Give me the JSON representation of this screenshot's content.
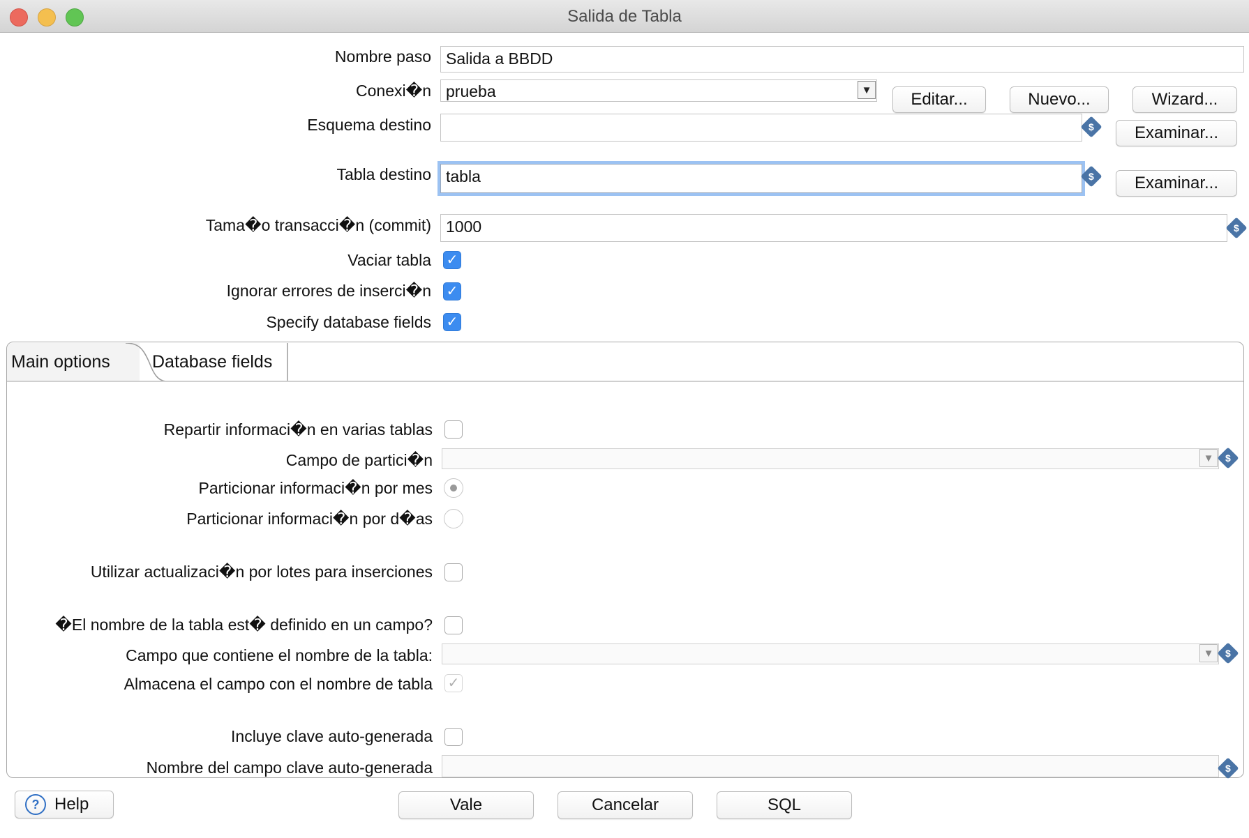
{
  "window": {
    "title": "Salida de Tabla"
  },
  "form": {
    "step_name": {
      "label": "Nombre paso",
      "value": "Salida a BBDD"
    },
    "connection": {
      "label": "Conexi�n",
      "value": "prueba"
    },
    "buttons": {
      "edit": "Editar...",
      "new": "Nuevo...",
      "wizard": "Wizard...",
      "browse": "Examinar..."
    },
    "target_schema": {
      "label": "Esquema destino",
      "value": ""
    },
    "target_table": {
      "label": "Tabla destino",
      "value": "tabla"
    },
    "commit_size": {
      "label": "Tama�o transacci�n (commit)",
      "value": "1000"
    },
    "truncate_table": {
      "label": "Vaciar tabla",
      "checked": true
    },
    "ignore_insert_errors": {
      "label": "Ignorar errores de inserci�n",
      "checked": true
    },
    "specify_db_fields": {
      "label": "Specify database fields",
      "checked": true
    }
  },
  "tabs": [
    {
      "label": "Main options",
      "active": true
    },
    {
      "label": "Database fields",
      "active": false
    }
  ],
  "main_options": {
    "partition_over_tables": {
      "label": "Repartir informaci�n en varias tablas",
      "checked": false
    },
    "partition_field": {
      "label": "Campo de partici�n",
      "value": ""
    },
    "partition_monthly": {
      "label": "Particionar informaci�n por mes",
      "selected": true
    },
    "partition_daily": {
      "label": "Particionar informaci�n por d�as",
      "selected": false
    },
    "batch_updates": {
      "label": "Utilizar actualizaci�n por lotes para inserciones",
      "checked": false
    },
    "table_name_in_field": {
      "label": "�El nombre de la tabla est� definido en un campo?",
      "checked": false
    },
    "table_name_field": {
      "label": "Campo que contiene el nombre de la tabla:",
      "value": ""
    },
    "store_table_name": {
      "label": "Almacena el campo con el nombre de tabla",
      "checked": true,
      "disabled": true
    },
    "return_auto_key": {
      "label": "Incluye clave auto-generada",
      "checked": false
    },
    "auto_key_field": {
      "label": "Nombre del campo clave auto-generada",
      "value": ""
    }
  },
  "footer": {
    "help": "Help",
    "ok": "Vale",
    "cancel": "Cancelar",
    "sql": "SQL"
  },
  "colors": {
    "accent": "#3c8cf0",
    "focus_ring": "#9cc2f2",
    "variable_icon": "#4a74a6"
  },
  "icons": {
    "variable": "dollar-diamond-icon",
    "help": "question-circle-icon",
    "dropdown": "triangle-down-icon"
  }
}
